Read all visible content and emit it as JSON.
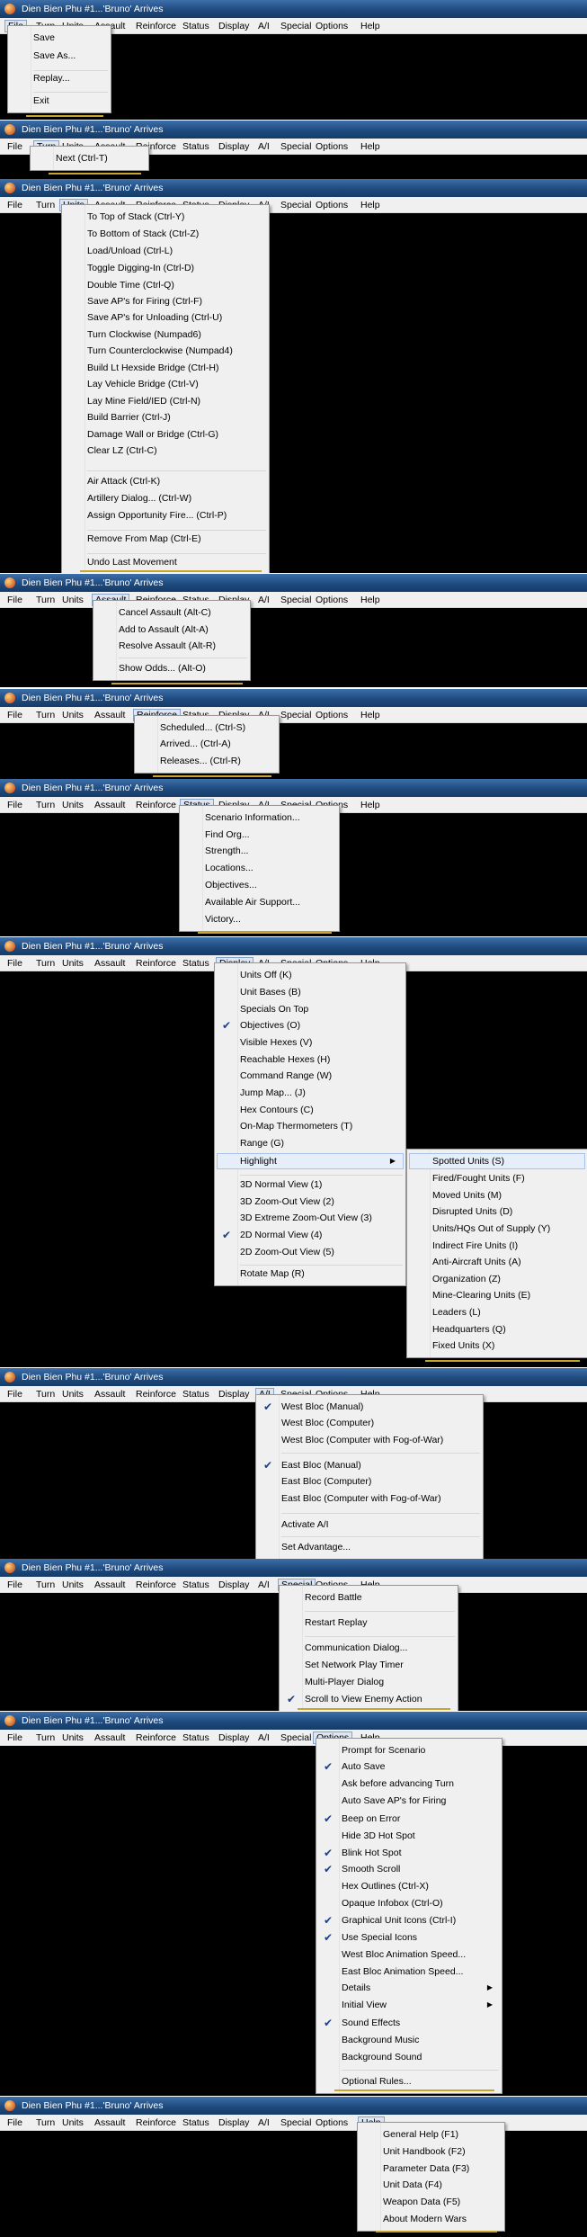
{
  "window_title": "Dien Bien Phu #1...'Bruno' Arrives",
  "menu_bar": [
    "File",
    "Turn",
    "Units",
    "Assault",
    "Reinforce",
    "Status",
    "Display",
    "A/I",
    "Special",
    "Options",
    "Help"
  ],
  "panels": [
    {
      "active_menu": "File",
      "items": [
        "Save",
        "Save As...",
        "Replay...",
        "Exit"
      ]
    },
    {
      "active_menu": "Turn",
      "items": [
        "Next (Ctrl-T)"
      ]
    },
    {
      "active_menu": "Units",
      "items": [
        "To Top of Stack (Ctrl-Y)",
        "To Bottom of Stack (Ctrl-Z)",
        "Load/Unload (Ctrl-L)",
        "Toggle Digging-In (Ctrl-D)",
        "Double Time (Ctrl-Q)",
        "Save AP's for Firing (Ctrl-F)",
        "Save AP's for Unloading (Ctrl-U)",
        "Turn Clockwise (Numpad6)",
        "Turn Counterclockwise (Numpad4)",
        "Build Lt Hexside Bridge (Ctrl-H)",
        "Lay Vehicle Bridge (Ctrl-V)",
        "Lay Mine Field/IED (Ctrl-N)",
        "Build Barrier (Ctrl-J)",
        "Damage Wall or Bridge (Ctrl-G)",
        "Clear LZ (Ctrl-C)",
        "Air Attack (Ctrl-K)",
        "Artillery Dialog... (Ctrl-W)",
        "Assign Opportunity Fire... (Ctrl-P)",
        "Remove From Map (Ctrl-E)",
        "Undo Last Movement"
      ]
    },
    {
      "active_menu": "Assault",
      "items": [
        "Cancel Assault (Alt-C)",
        "Add to Assault (Alt-A)",
        "Resolve Assault (Alt-R)",
        "Show Odds... (Alt-O)"
      ]
    },
    {
      "active_menu": "Reinforce",
      "items": [
        "Scheduled... (Ctrl-S)",
        "Arrived... (Ctrl-A)",
        "Releases... (Ctrl-R)"
      ]
    },
    {
      "active_menu": "Status",
      "items": [
        "Scenario Information...",
        "Find Org...",
        "Strength...",
        "Locations...",
        "Objectives...",
        "Available Air Support...",
        "Victory..."
      ]
    },
    {
      "active_menu": "Display",
      "items": [
        "Units Off (K)",
        "Unit Bases (B)",
        "Specials On Top",
        "Objectives (O)",
        "Visible Hexes (V)",
        "Reachable Hexes (H)",
        "Command Range (W)",
        "Jump Map... (J)",
        "Hex Contours (C)",
        "On-Map Thermometers (T)",
        "Range (G)",
        "Highlight",
        "3D Normal View (1)",
        "3D Zoom-Out View (2)",
        "3D Extreme Zoom-Out View (3)",
        "2D Normal View (4)",
        "2D Zoom-Out View (5)",
        "Rotate Map (R)"
      ],
      "submenu": [
        "Spotted Units (S)",
        "Fired/Fought Units (F)",
        "Moved Units (M)",
        "Disrupted Units (D)",
        "Units/HQs Out of Supply (Y)",
        "Indirect Fire Units (I)",
        "Anti-Aircraft Units (A)",
        "Organization (Z)",
        "Mine-Clearing Units (E)",
        "Leaders (L)",
        "Headquarters (Q)",
        "Fixed Units (X)"
      ]
    },
    {
      "active_menu": "A/I",
      "items": [
        "West Bloc (Manual)",
        "West Bloc (Computer)",
        "West Bloc (Computer with Fog-of-War)",
        "East Bloc (Manual)",
        "East Bloc (Computer)",
        "East Bloc (Computer with Fog-of-War)",
        "Activate A/I",
        "Set Advantage..."
      ]
    },
    {
      "active_menu": "Special",
      "items": [
        "Record Battle",
        "Restart Replay",
        "Communication Dialog...",
        "Set Network Play Timer",
        "Multi-Player Dialog",
        "Scroll to View Enemy Action"
      ]
    },
    {
      "active_menu": "Options",
      "items": [
        "Prompt for Scenario",
        "Auto Save",
        "Ask before advancing Turn",
        "Auto Save AP's for Firing",
        "Beep on Error",
        "Hide 3D Hot Spot",
        "Blink Hot Spot",
        "Smooth Scroll",
        "Hex Outlines (Ctrl-X)",
        "Opaque Infobox (Ctrl-O)",
        "Graphical Unit Icons (Ctrl-I)",
        "Use Special Icons",
        "West Bloc Animation Speed...",
        "East Bloc Animation Speed...",
        "Details",
        "Initial View",
        "Sound Effects",
        "Background Music",
        "Background Sound",
        "Optional Rules..."
      ]
    },
    {
      "active_menu": "Help",
      "items": [
        "General Help (F1)",
        "Unit Handbook (F2)",
        "Parameter Data (F3)",
        "Unit Data (F4)",
        "Weapon Data (F5)",
        "About Modern Wars"
      ]
    }
  ],
  "colors": {
    "title_bar": "#1f4b7f",
    "menu_bg": "#f0f0f0",
    "map_bg": "#000000",
    "check_mark": "#1a3f8e",
    "hover_bar": "#c8a430"
  }
}
